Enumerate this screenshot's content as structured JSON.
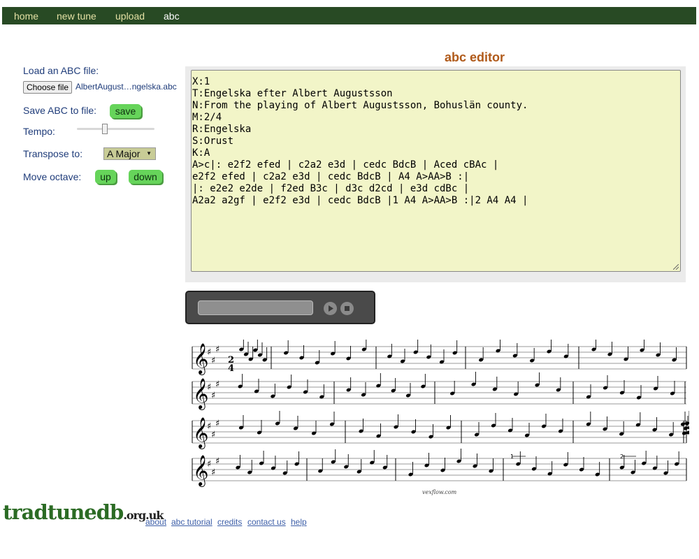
{
  "nav": {
    "items": [
      {
        "label": "home"
      },
      {
        "label": "new tune"
      },
      {
        "label": "upload"
      },
      {
        "label": "abc",
        "active": true
      }
    ]
  },
  "sidebar": {
    "load_label": "Load an ABC file:",
    "choose_file_label": "Choose file",
    "file_name": "AlbertAugust…ngelska.abc",
    "save_label": "Save ABC to file:",
    "save_button": "save",
    "tempo_label": "Tempo:",
    "tempo_level": 0.35,
    "transpose_label": "Transpose to:",
    "transpose_value": "A Major",
    "octave_label": "Move octave:",
    "octave_up": "up",
    "octave_down": "down"
  },
  "editor": {
    "title": "abc editor",
    "abc_lines": [
      "X:1",
      "T:Engelska efter Albert Augustsson",
      "N:From the playing of Albert Augustsson, Bohuslän county.",
      "M:2/4",
      "R:Engelska",
      "S:Orust",
      "K:A",
      "A>c|: e2f2 efed | c2a2 e3d | cedc BdcB | Aced cBAc |",
      "e2f2 efed | c2a2 e3d | cedc BdcB | A4 A>AA>B :|",
      "|: e2e2 e2de | f2ed B3c | d3c d2cd | e3d cdBc |",
      "A2a2 a2gf | e2f2 e3d | cedc BdcB |1 A4 A>AA>B :|2 A4 A4 |"
    ]
  },
  "player": {
    "progress": 0,
    "play_icon": "play-icon",
    "stop_icon": "stop-icon"
  },
  "score": {
    "time_signature": {
      "top": "2",
      "bottom": "4"
    },
    "ending_1": "1",
    "ending_2": "2",
    "credit": "vexflow.com"
  },
  "footer": {
    "logo_main": "tradtunedb",
    "logo_tld": ".org.uk",
    "links": [
      {
        "label": "about"
      },
      {
        "label": "abc tutorial"
      },
      {
        "label": "credits"
      },
      {
        "label": "contact us"
      },
      {
        "label": "help"
      }
    ]
  },
  "colors": {
    "nav_bg": "#284a24",
    "nav_link": "#e3e0a4",
    "editor_bg": "#f2f5c8",
    "button_green": "#66d45a",
    "title_orange": "#b05a1a",
    "logo_green": "#2b6b24",
    "link_blue": "#3d5fa8"
  }
}
